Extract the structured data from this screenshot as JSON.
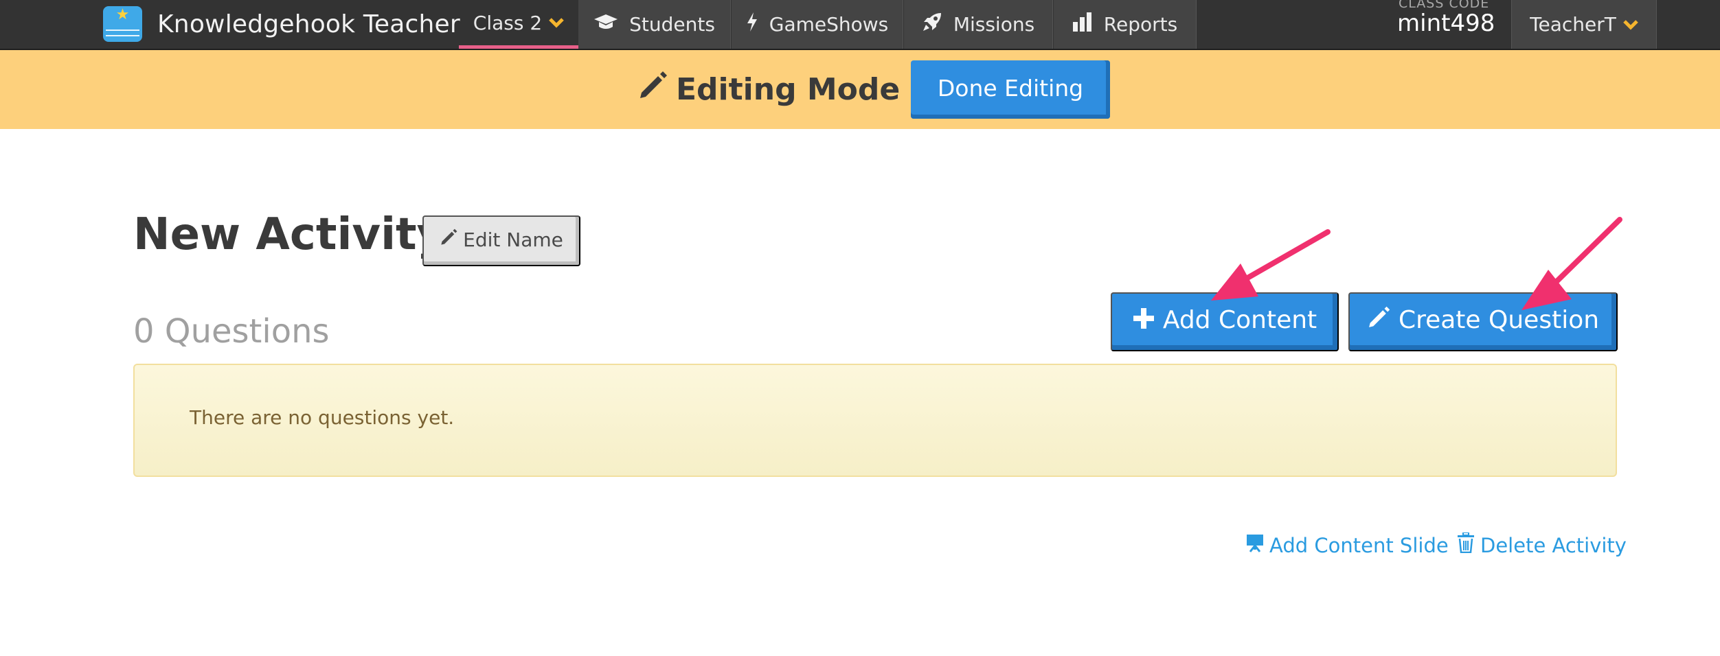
{
  "navbar": {
    "brand_name": "Knowledgehook Teacher",
    "logo_icon": "book-star-icon",
    "items": [
      {
        "label": "Class 2",
        "icon": "chevron-down-icon"
      },
      {
        "label": "Students",
        "icon": "graduation-cap-icon"
      },
      {
        "label": "GameShows",
        "icon": "lightning-bolt-icon"
      },
      {
        "label": "Missions",
        "icon": "rocket-icon"
      },
      {
        "label": "Reports",
        "icon": "bar-chart-icon"
      }
    ],
    "class_code_label": "CLASS CODE",
    "class_code_value": "mint498",
    "user_menu_label": "TeacherT"
  },
  "edit_banner": {
    "title": "Editing Mode",
    "done_label": "Done Editing"
  },
  "activity": {
    "title": "New Activity",
    "edit_name_label": "Edit Name",
    "questions_count": "0 Questions",
    "add_content_label": "Add Content",
    "create_question_label": "Create Question",
    "empty_message": "There are no questions yet.",
    "add_content_slide_label": "Add Content Slide",
    "delete_activity_label": "Delete Activity"
  },
  "colors": {
    "navbar_bg": "#333333",
    "banner_bg": "#fdd07c",
    "primary_blue": "#2f8ee0",
    "link_blue": "#2a9be0",
    "accent_pink": "#f0306e",
    "chevron_orange": "#f5b52e"
  }
}
